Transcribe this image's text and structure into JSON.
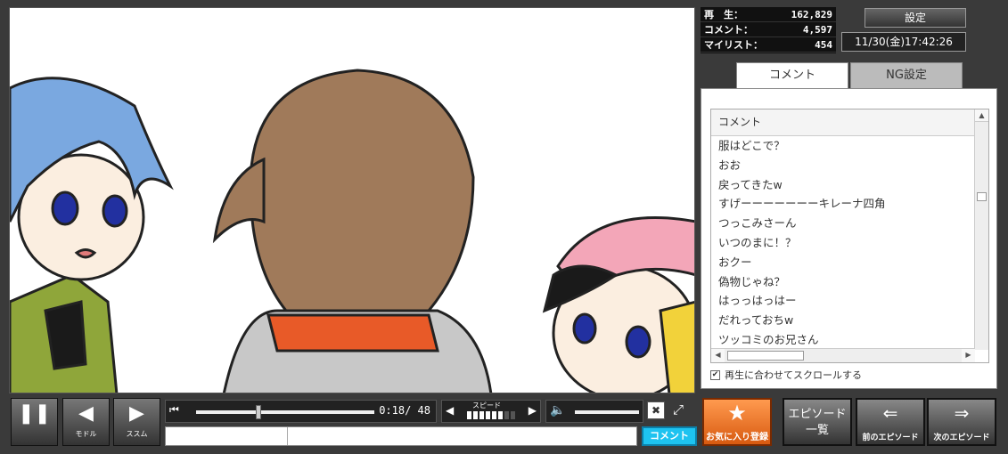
{
  "stats": {
    "play_label": "再　生：",
    "play_value": "162,829",
    "comment_label": "コメント：",
    "comment_value": "4,597",
    "mylist_label": "マイリスト：",
    "mylist_value": "454"
  },
  "settings_label": "設定",
  "clock": "11/30(金)17:42:26",
  "tabs": [
    "コメント",
    "NG設定"
  ],
  "comment_list": {
    "header": "コメント",
    "items": [
      "服はどこで？",
      "おお",
      "戻ってきたw",
      "すげーーーーーーーキレーナ四角",
      "つっこみさーん",
      "いつのまに！？",
      "おクー",
      "偽物じゃね？",
      "はっっはっはー",
      "だれっておちw",
      "ツッコミのお兄さん"
    ],
    "autoscroll_label": "再生に合わせてスクロールする",
    "autoscroll_checked": true
  },
  "controls": {
    "back_label": "モドル",
    "forward_label": "ススム",
    "time": "0:18/ 48",
    "speed_label": "スピード",
    "speed_level": 6,
    "speed_max": 8,
    "seek_fraction": 0.35,
    "volume_fraction": 1.0,
    "submit_label": "コメント"
  },
  "actions": {
    "favorite_label": "お気に入り登録",
    "episode_list_label_1": "エピソード",
    "episode_list_label_2": "一覧",
    "prev_episode_label": "前のエピソード",
    "next_episode_label": "次のエピソード"
  },
  "colors": {
    "accent_orange": "#e8702a",
    "submit_blue": "#1ec3f0"
  }
}
